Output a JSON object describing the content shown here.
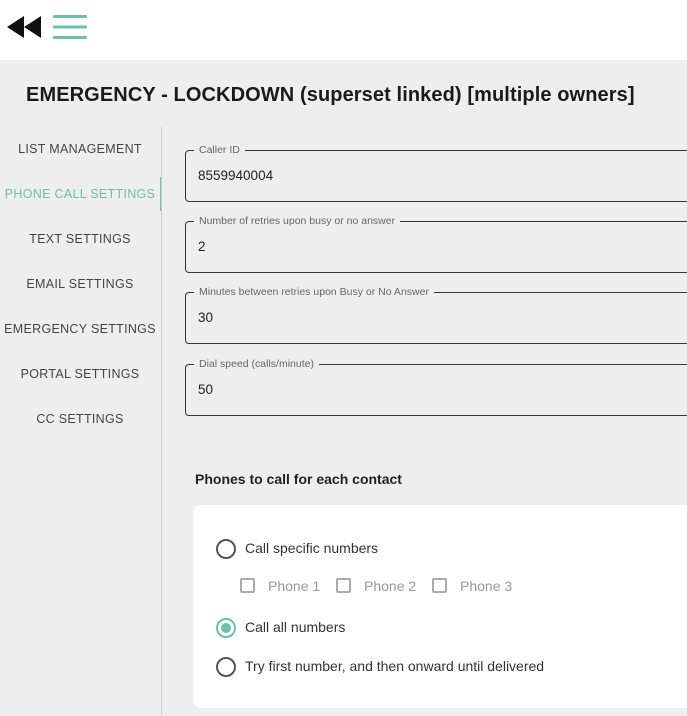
{
  "header": {
    "back_icon": "rewind-icon",
    "menu_icon": "hamburger-menu-icon",
    "icon_color": "#6cc0ac"
  },
  "page": {
    "title": "EMERGENCY - LOCKDOWN (superset linked) [multiple owners]"
  },
  "sidebar": {
    "active_color": "#6cc0ac",
    "items": [
      {
        "label": "LIST MANAGEMENT",
        "active": false
      },
      {
        "label": "PHONE CALL SETTINGS",
        "active": true
      },
      {
        "label": "TEXT SETTINGS",
        "active": false
      },
      {
        "label": "EMAIL SETTINGS",
        "active": false
      },
      {
        "label": "EMERGENCY SETTINGS",
        "active": false
      },
      {
        "label": "PORTAL SETTINGS",
        "active": false
      },
      {
        "label": "CC SETTINGS",
        "active": false
      }
    ]
  },
  "form": {
    "caller_id": {
      "label": "Caller ID",
      "value": "8559940004"
    },
    "retries": {
      "label": "Number of retries upon busy or no answer",
      "value": "2"
    },
    "retry_minutes": {
      "label": "Minutes between retries upon Busy or No Answer",
      "value": "30"
    },
    "dial_speed": {
      "label": "Dial speed (calls/minute)",
      "value": "50"
    }
  },
  "phones_section": {
    "title": "Phones to call for each contact",
    "options": [
      {
        "label": "Call specific numbers",
        "checked": false
      },
      {
        "label": "Call all numbers",
        "checked": true
      },
      {
        "label": "Try first number, and then onward until delivered",
        "checked": false
      }
    ],
    "specific_numbers": [
      {
        "label": "Phone 1",
        "checked": false,
        "disabled": true
      },
      {
        "label": "Phone 2",
        "checked": false,
        "disabled": true
      },
      {
        "label": "Phone 3",
        "checked": false,
        "disabled": true
      }
    ]
  }
}
